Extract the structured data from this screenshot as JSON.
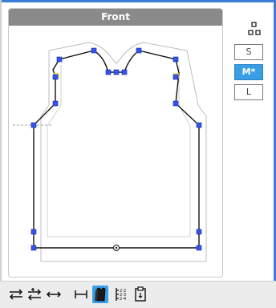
{
  "panel": {
    "title": "Front"
  },
  "sizes": [
    {
      "label": "S",
      "active": false
    },
    {
      "label": "M*",
      "active": true
    },
    {
      "label": "L",
      "active": false
    }
  ],
  "icons": {
    "layout": "grid-layout-icon",
    "toolbar": [
      "swap-horizontal-icon",
      "adjust-rows-icon",
      "arrow-both-ways-icon",
      "width-measure-icon",
      "garment-view-icon",
      "pattern-repeat-icon",
      "paste-icon"
    ]
  },
  "colors": {
    "accent": "#3a9ee6",
    "header": "#8a8a8a",
    "handle": "#3355ee",
    "highlight": "#e8d44a"
  }
}
